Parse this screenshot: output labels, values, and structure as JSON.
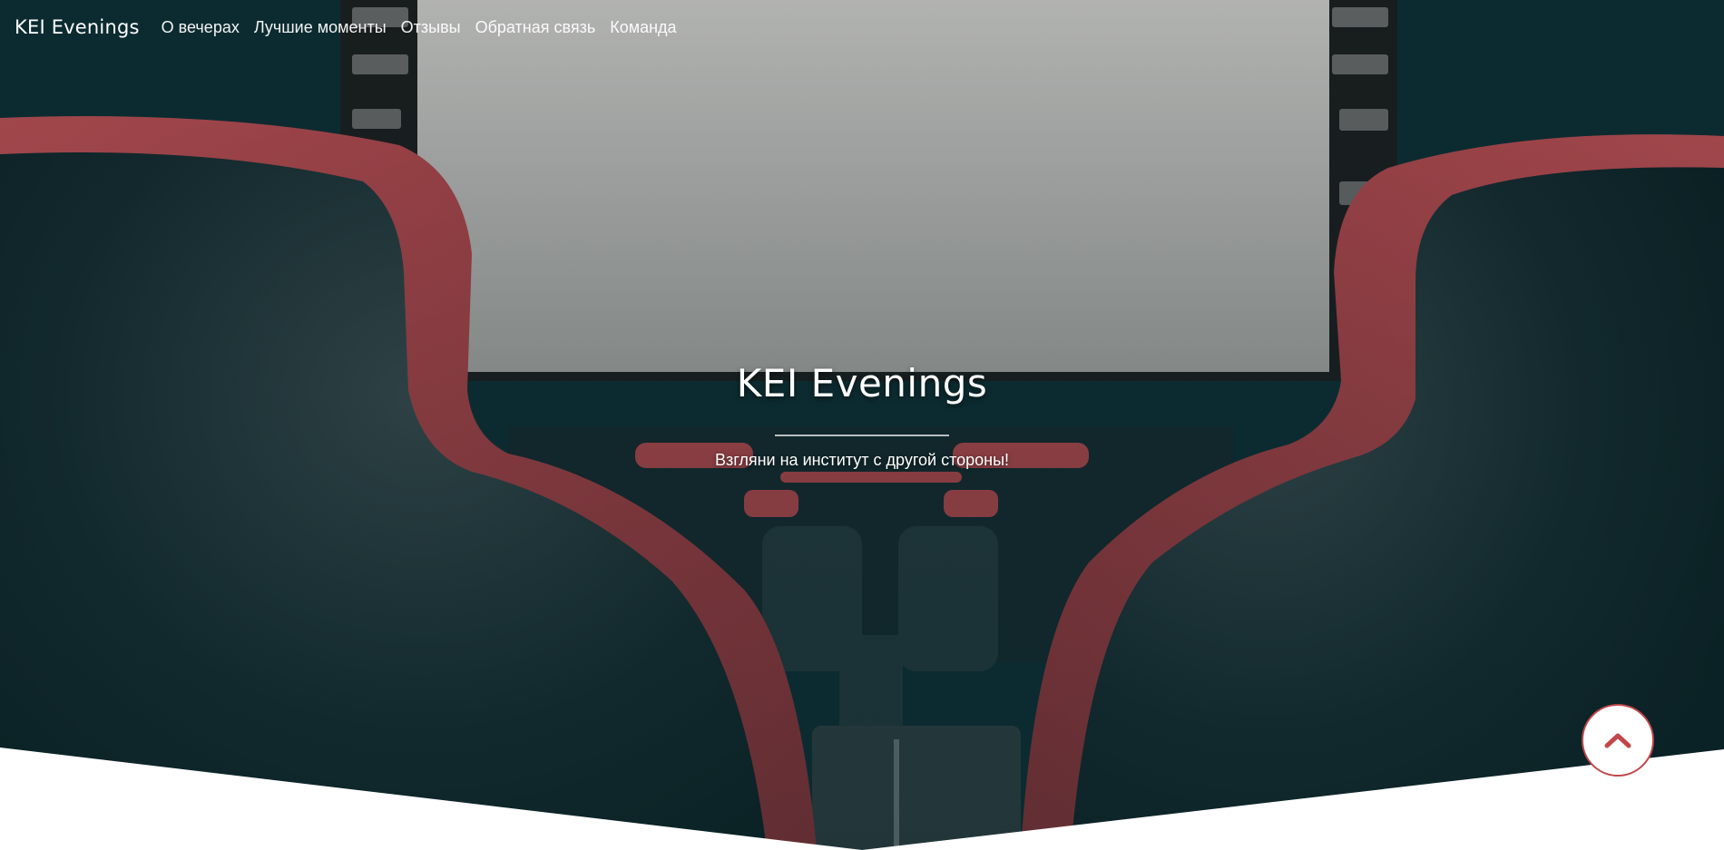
{
  "brand": "KEI Evenings",
  "nav": {
    "items": [
      {
        "label": "О вечерах"
      },
      {
        "label": "Лучшие моменты"
      },
      {
        "label": "Отзывы"
      },
      {
        "label": "Обратная связь"
      },
      {
        "label": "Команда"
      }
    ]
  },
  "masthead": {
    "title": "KEI Evenings",
    "subtitle": "Взгляни на институт с другой стороны!"
  },
  "scroll_top": {
    "icon": "chevron-up-icon"
  },
  "colors": {
    "accent": "#c0474a",
    "background_dark": "#0b2a2f",
    "seat_red": "#b8454a"
  }
}
